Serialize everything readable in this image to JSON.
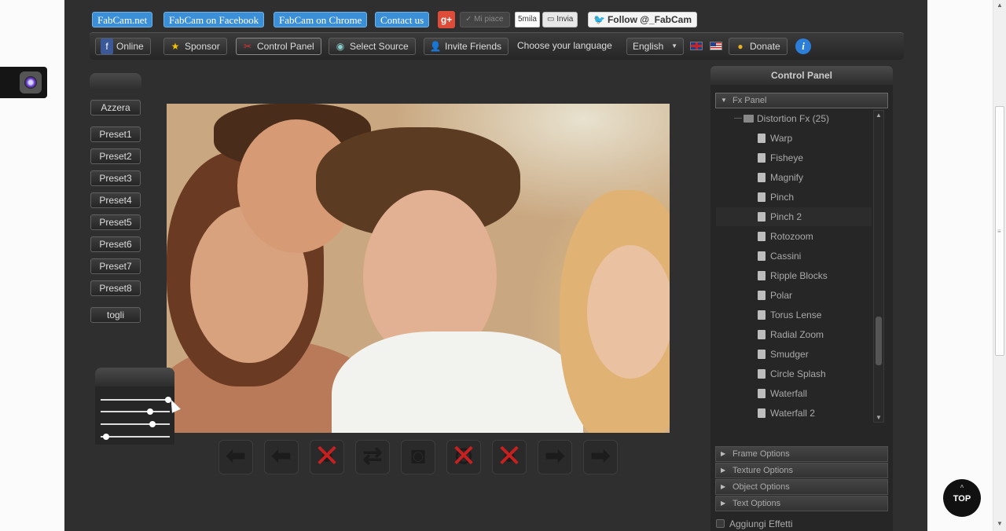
{
  "top_links": [
    "FabCam.net",
    "FabCam on Facebook",
    "FabCam on Chrome",
    "Contact us"
  ],
  "social": {
    "gplus": "g+",
    "like": "Mi piace",
    "like_count": "5mila",
    "send": "Invia",
    "twitter": "Follow @_FabCam"
  },
  "toolbar": {
    "online": "Online",
    "sponsor": "Sponsor",
    "control_panel": "Control Panel",
    "select_source": "Select Source",
    "invite_friends": "Invite Friends",
    "choose_language": "Choose your language",
    "language": "English",
    "donate": "Donate",
    "info": "i"
  },
  "presets": {
    "reset": "Azzera",
    "items": [
      "Preset1",
      "Preset2",
      "Preset3",
      "Preset4",
      "Preset5",
      "Preset6",
      "Preset7",
      "Preset8"
    ],
    "remove": "togli"
  },
  "sliders": [
    0.98,
    0.72,
    0.75,
    0.08
  ],
  "control_panel": {
    "title": "Control Panel",
    "fx_panel": "Fx Panel",
    "folder": "Distortion Fx (25)",
    "items": [
      "Warp",
      "Fisheye",
      "Magnify",
      "Pinch",
      "Pinch 2",
      "Rotozoom",
      "Cassini",
      "Ripple Blocks",
      "Polar",
      "Torus Lense",
      "Radial Zoom",
      "Smudger",
      "Circle Splash",
      "Waterfall",
      "Waterfall 2"
    ],
    "highlighted": "Pinch 2",
    "sections": [
      "Frame Options",
      "Texture Options",
      "Object Options",
      "Text Options"
    ],
    "add_effects": "Aggiungi Effetti"
  },
  "controls": [
    "arrow-left-icon",
    "arrow-left-alt-icon",
    "cancel-icon",
    "swap-icon",
    "camera-icon",
    "cancel-circle-icon",
    "cancel-alt-icon",
    "arrow-right-icon",
    "arrow-right-alt-icon"
  ],
  "top_button": "TOP",
  "colors": {
    "link_blue": "#3b8fd6",
    "panel_bg": "#2f2f2f",
    "cancel_red": "#c62020"
  }
}
